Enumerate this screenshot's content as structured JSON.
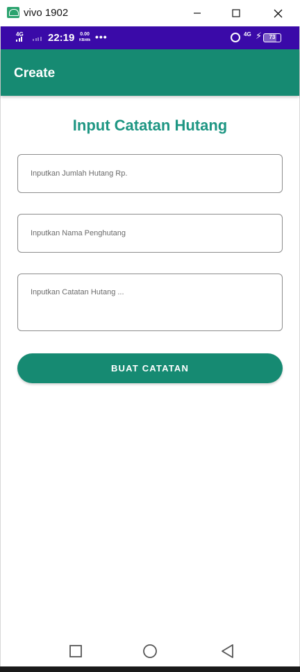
{
  "window": {
    "title": "vivo 1902",
    "icon": "android-app-icon"
  },
  "status_bar": {
    "network_left": "4G",
    "time": "22:19",
    "speed_value": "0.00",
    "speed_unit": "KB/dtk",
    "more": "•••",
    "network_right": "4G",
    "battery_level": "73",
    "icons": [
      "signal-icon",
      "alarm-icon",
      "charging-icon",
      "battery-icon"
    ],
    "background_color": "#3a0aa8"
  },
  "app_bar": {
    "title": "Create",
    "color": "#168a72"
  },
  "form": {
    "heading": "Input Catatan Hutang",
    "heading_color": "#1e9683",
    "amount_placeholder": "Inputkan Jumlah Hutang Rp.",
    "amount_value": "",
    "name_placeholder": "Inputkan Nama Penghutang",
    "name_value": "",
    "note_placeholder": "Inputkan Catatan Hutang ...",
    "note_value": "",
    "submit_label": "BUAT CATATAN"
  },
  "nav_bar": {
    "icons": [
      "recents-icon",
      "home-icon",
      "back-icon"
    ]
  }
}
